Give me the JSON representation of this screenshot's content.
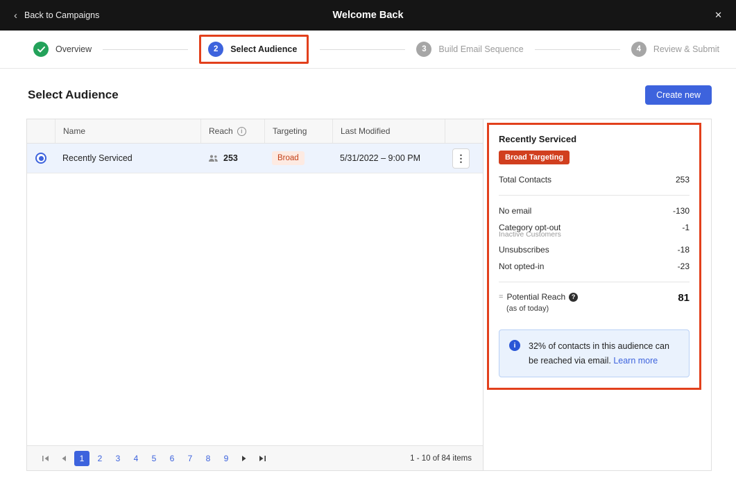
{
  "topbar": {
    "back_chevron": "‹",
    "back_label": "Back to Campaigns",
    "title": "Welcome Back",
    "close_glyph": "✕"
  },
  "stepper": {
    "steps": [
      {
        "number": "1",
        "label": "Overview",
        "state": "complete"
      },
      {
        "number": "2",
        "label": "Select Audience",
        "state": "active"
      },
      {
        "number": "3",
        "label": "Build Email Sequence",
        "state": "upcoming"
      },
      {
        "number": "4",
        "label": "Review & Submit",
        "state": "upcoming"
      }
    ]
  },
  "page": {
    "title": "Select Audience",
    "create_button": "Create new"
  },
  "table": {
    "columns": [
      "",
      "Name",
      "Reach",
      "Targeting",
      "Last Modified",
      ""
    ],
    "reach_info_glyph": "i",
    "rows": [
      {
        "name": "Recently Serviced",
        "reach": "253",
        "targeting": "Broad",
        "last_modified": "5/31/2022 – 9:00 PM",
        "selected": true,
        "kebab_glyph": "⋮"
      }
    ]
  },
  "pagination": {
    "pages": [
      "1",
      "2",
      "3",
      "4",
      "5",
      "6",
      "7",
      "8",
      "9"
    ],
    "current": "1",
    "summary": "1 - 10 of 84 items"
  },
  "panel": {
    "title": "Recently Serviced",
    "badge": "Broad Targeting",
    "total_label": "Total Contacts",
    "total_value": "253",
    "deductions": [
      {
        "label": "No email",
        "value": "-130"
      },
      {
        "label": "Category opt-out",
        "value": "-1",
        "sub": "Inactive Customers"
      },
      {
        "label": "Unsubscribes",
        "value": "-18"
      },
      {
        "label": "Not opted-in",
        "value": "-23"
      }
    ],
    "potential": {
      "prefix": "=",
      "label": "Potential Reach",
      "help_glyph": "?",
      "sub": "(as of today)",
      "value": "81"
    },
    "info": {
      "icon_glyph": "i",
      "text": "32% of contacts in this audience can be reached via email.",
      "link": "Learn more"
    }
  },
  "colors": {
    "accent_blue": "#3d63dd",
    "annotation_red": "#e2401c",
    "badge_red": "#d13f1f",
    "success_green": "#23a25a",
    "topbar_bg": "#151515",
    "row_selected_bg": "#edf3fd",
    "info_box_bg": "#eaf2fd"
  }
}
